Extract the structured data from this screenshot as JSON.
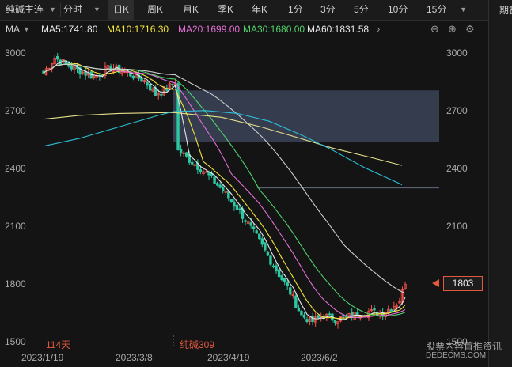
{
  "toolbar": {
    "symbol": "纯碱主连",
    "periods": [
      "分时",
      "日K",
      "周K",
      "月K",
      "季K",
      "年K",
      "1分",
      "3分",
      "5分",
      "10分",
      "15分"
    ],
    "active_period": "日K"
  },
  "ma_legend": {
    "label": "MA",
    "items": [
      {
        "text": "MA5:1741.80",
        "color": "#e8e8e8"
      },
      {
        "text": "MA10:1716.30",
        "color": "#f2e33a"
      },
      {
        "text": "MA20:1699.00",
        "color": "#e56fd6"
      },
      {
        "text": "MA30:1680.00",
        "color": "#4fd06c"
      },
      {
        "text": "MA60:1831.58",
        "color": "#e8e8e8"
      }
    ]
  },
  "right_panel": {
    "title": "期货"
  },
  "range_start_label": "114天",
  "contract_switch_label": "纯碱309",
  "last_price_tag": "1803",
  "watermark": {
    "line1": "股票内容首推资讯",
    "line2": "DEDECMS.COM"
  },
  "icons": [
    "chevron-down-icon",
    "chevron-right-icon",
    "zoom-out-icon",
    "zoom-in-icon",
    "settings-icon"
  ],
  "colors": {
    "up": "#f5524a",
    "down": "#2ec7a3",
    "ma5": "#e8e8e8",
    "ma10": "#f2e33a",
    "ma20": "#e56fd6",
    "ma30": "#4fd06c",
    "ma60": "#cfcfcf",
    "ma_long1": "#e6e08a",
    "ma_long2": "#2bc0d8",
    "gap_box": "#3a4358"
  },
  "chart_data": {
    "type": "candlestick",
    "yticks": [
      3000,
      2700,
      2400,
      2100,
      1800,
      1500
    ],
    "xticks": [
      "2023/1/19",
      "2023/3/8",
      "2023/4/19",
      "2023/6/2"
    ],
    "ylim": [
      1500,
      3000
    ],
    "last_price": 1803,
    "gap_box": {
      "price_high": 2810,
      "price_low": 2540
    },
    "gap_line_price": 2305,
    "anchors": [
      {
        "i": 0,
        "p": 2900
      },
      {
        "i": 4,
        "p": 2980
      },
      {
        "i": 10,
        "p": 2930
      },
      {
        "i": 18,
        "p": 2880
      },
      {
        "i": 24,
        "p": 2930
      },
      {
        "i": 30,
        "p": 2900
      },
      {
        "i": 36,
        "p": 2860
      },
      {
        "i": 40,
        "p": 2790
      },
      {
        "i": 44,
        "p": 2820
      },
      {
        "i": 47,
        "p": 2850
      },
      {
        "i": 48,
        "p": 2500
      },
      {
        "i": 52,
        "p": 2450
      },
      {
        "i": 58,
        "p": 2380
      },
      {
        "i": 64,
        "p": 2290
      },
      {
        "i": 70,
        "p": 2180
      },
      {
        "i": 76,
        "p": 2050
      },
      {
        "i": 82,
        "p": 1900
      },
      {
        "i": 88,
        "p": 1760
      },
      {
        "i": 92,
        "p": 1640
      },
      {
        "i": 96,
        "p": 1610
      },
      {
        "i": 100,
        "p": 1640
      },
      {
        "i": 104,
        "p": 1620
      },
      {
        "i": 108,
        "p": 1630
      },
      {
        "i": 112,
        "p": 1650
      },
      {
        "i": 116,
        "p": 1660
      },
      {
        "i": 120,
        "p": 1650
      },
      {
        "i": 124,
        "p": 1680
      },
      {
        "i": 127,
        "p": 1720
      },
      {
        "i": 129,
        "p": 1803
      }
    ]
  }
}
